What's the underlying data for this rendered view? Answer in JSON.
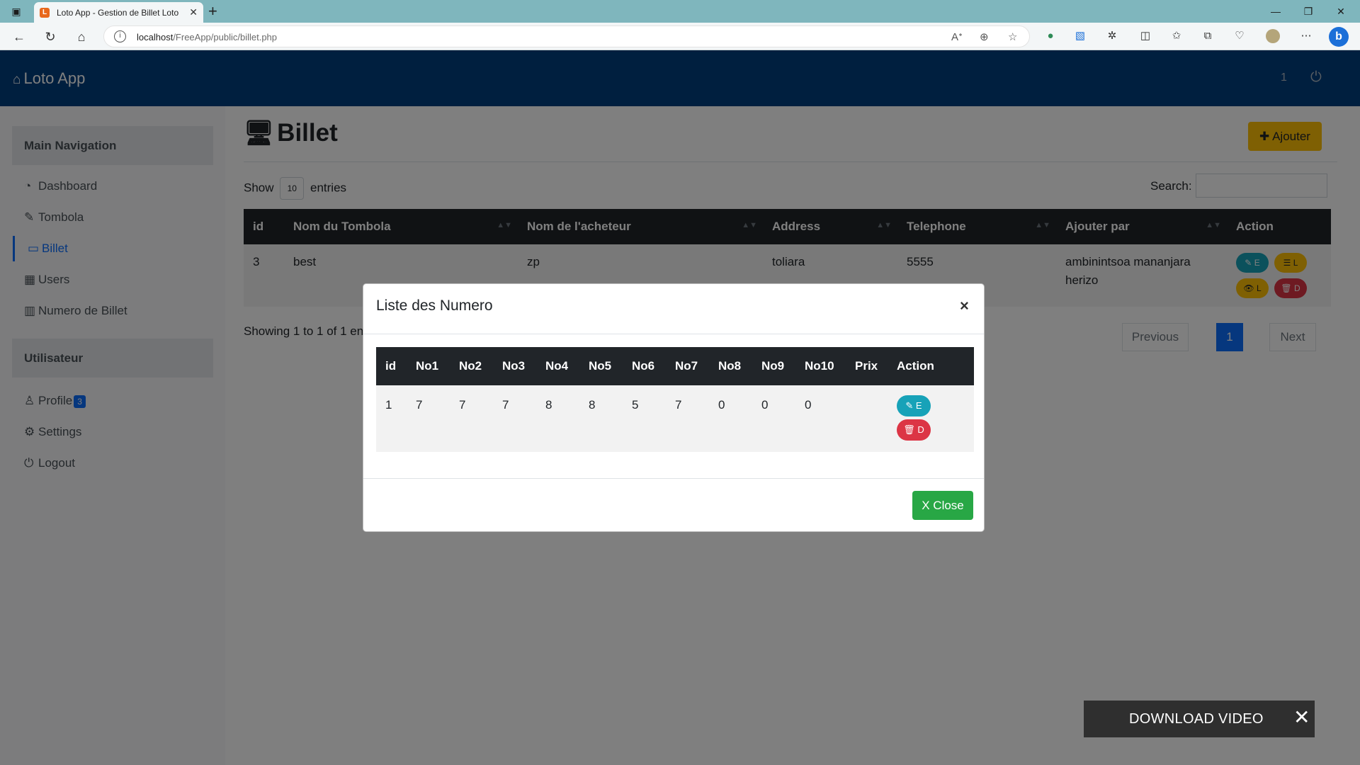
{
  "browser": {
    "tab_title": "Loto App - Gestion de Billet Loto",
    "tab_favicon": "L",
    "close_glyph": "✕",
    "new_tab_glyph": "+",
    "url_host": "localhost",
    "url_path": "/FreeApp/public/billet.php",
    "window_controls": [
      "—",
      "❐",
      "✕"
    ]
  },
  "navbar": {
    "brand": "Loto App",
    "count": "1"
  },
  "sidebar": {
    "main_nav_header": "Main Navigation",
    "items": [
      {
        "label": "Dashboard",
        "icon": "dashboard-icon"
      },
      {
        "label": "Tombola",
        "icon": "edit-icon"
      },
      {
        "label": "Billet",
        "icon": "desktop-icon",
        "active": true
      },
      {
        "label": "Users",
        "icon": "table-icon"
      },
      {
        "label": "Numero de Billet",
        "icon": "bar-chart-icon"
      }
    ],
    "user_header": "Utilisateur",
    "user_items": [
      {
        "label": "Profile",
        "icon": "user-icon",
        "badge": "3"
      },
      {
        "label": "Settings",
        "icon": "gear-icon"
      },
      {
        "label": "Logout",
        "icon": "power-icon"
      }
    ]
  },
  "page": {
    "title": "Billet",
    "add_button": "Ajouter",
    "show_label": "Show",
    "show_value": "10",
    "entries_label": "entries",
    "search_label": "Search:",
    "search_value": "",
    "showing_text": "Showing 1 to 1 of 1 entries"
  },
  "table": {
    "headers": [
      "id",
      "Nom du Tombola",
      "Nom de l'acheteur",
      "Address",
      "Telephone",
      "Ajouter par",
      "Action"
    ],
    "rows": [
      {
        "id": "3",
        "tombola": "best",
        "acheteur": "zp",
        "address": "toliara",
        "telephone": "5555",
        "ajouter_par": "ambinintsoa mananjara herizo"
      }
    ],
    "action_labels": {
      "edit": "E",
      "list": "L",
      "view": "L",
      "delete": "D"
    }
  },
  "pagination": {
    "previous": "Previous",
    "current": "1",
    "next": "Next"
  },
  "modal": {
    "title": "Liste des Numero",
    "close_x": "×",
    "headers": [
      "id",
      "No1",
      "No2",
      "No3",
      "No4",
      "No5",
      "No6",
      "No7",
      "No8",
      "No9",
      "No10",
      "Prix",
      "Action"
    ],
    "row": [
      "1",
      "7",
      "7",
      "7",
      "8",
      "8",
      "5",
      "7",
      "0",
      "0",
      "0",
      ""
    ],
    "edit_label": "E",
    "delete_label": "D",
    "close_button": "X Close"
  },
  "download_bar": {
    "label": "DOWNLOAD VIDEO",
    "close": "✕"
  },
  "colors": {
    "navbar": "#003f7f",
    "primary": "#0d6efd",
    "warning": "#ffc107",
    "danger": "#dc3545",
    "info": "#17a2b8",
    "success": "#28a745"
  }
}
